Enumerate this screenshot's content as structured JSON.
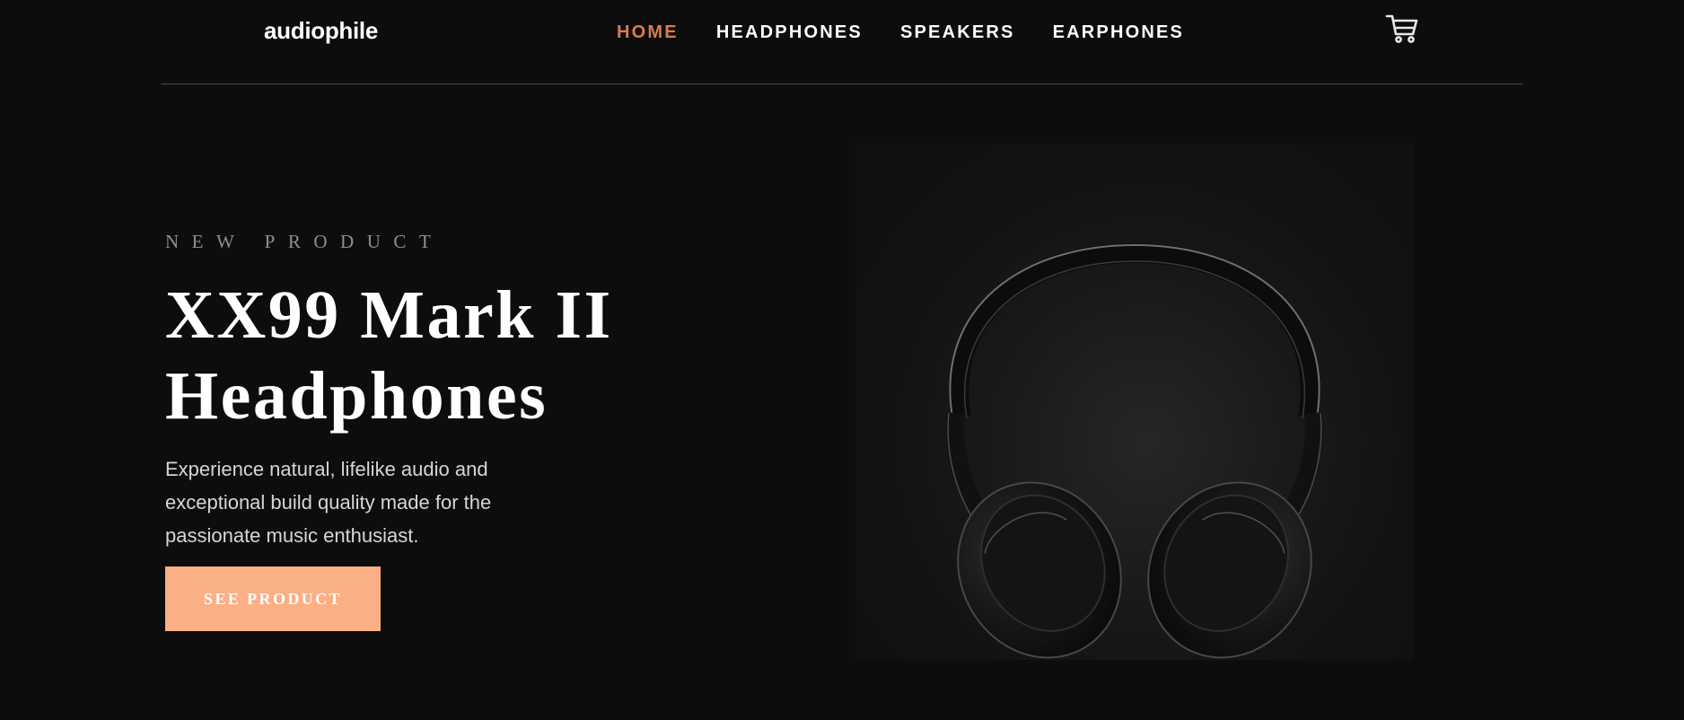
{
  "header": {
    "logo": "audiophile",
    "nav": [
      {
        "label": "HOME",
        "active": true
      },
      {
        "label": "HEADPHONES",
        "active": false
      },
      {
        "label": "SPEAKERS",
        "active": false
      },
      {
        "label": "EARPHONES",
        "active": false
      }
    ],
    "cart_icon": "cart-icon"
  },
  "hero": {
    "overline": "NEW PRODUCT",
    "title_line1": "XX99 Mark II",
    "title_line2": "Headphones",
    "description": "Experience natural, lifelike audio and exceptional build quality made for the passionate music enthusiast.",
    "cta_label": "SEE PRODUCT",
    "image_subject": "headphones-photo"
  },
  "colors": {
    "background": "#0d0d0d",
    "accent": "#d87d4a",
    "button": "#fbaf85",
    "text": "#ffffff",
    "muted_text": "#8f8f8f",
    "divider": "#4a4a4a"
  }
}
